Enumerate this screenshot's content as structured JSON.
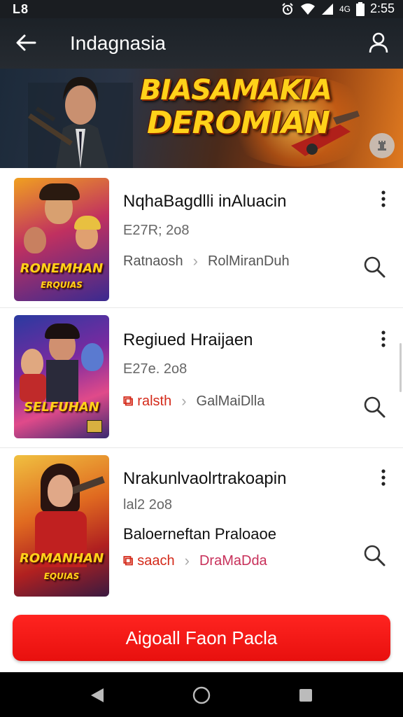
{
  "status_bar": {
    "left_text": "L8",
    "network": "4G",
    "time": "2:55"
  },
  "app_bar": {
    "title": "Indagnasia"
  },
  "banner": {
    "title_line1": "BIASAMAKIA",
    "title_line2": "DEROMIAN"
  },
  "items": [
    {
      "name": "NqhaBagdlli inAluacin",
      "date": "E27R; 2o8",
      "tag": "Ratnaosh",
      "category": "RolMiranDuh",
      "thumb_label_big": "RONEMHAN",
      "thumb_label_small": "ERQUIAS"
    },
    {
      "name": "Regiued Hraijaen",
      "date": "E27e. 2o8",
      "tag": "ralsth",
      "category": "GalMaiDlla",
      "thumb_label_big": "SELFUHAN",
      "thumb_label_small": ""
    },
    {
      "name": "Nrakunlvaolrtrakoapin",
      "date": "lal2 2o8",
      "subtitle": "Baloerneftan Praloaoe",
      "tag": "saach",
      "category": "DraMaDda",
      "thumb_label_big": "ROMANHAN",
      "thumb_label_small": "EQUIAS"
    }
  ],
  "cta": {
    "label": "Aigoall Faon Pacla"
  },
  "colors": {
    "accent": "#ff1a1a",
    "banner_title": "#ffd21a",
    "tag_red": "#d42a1a"
  }
}
